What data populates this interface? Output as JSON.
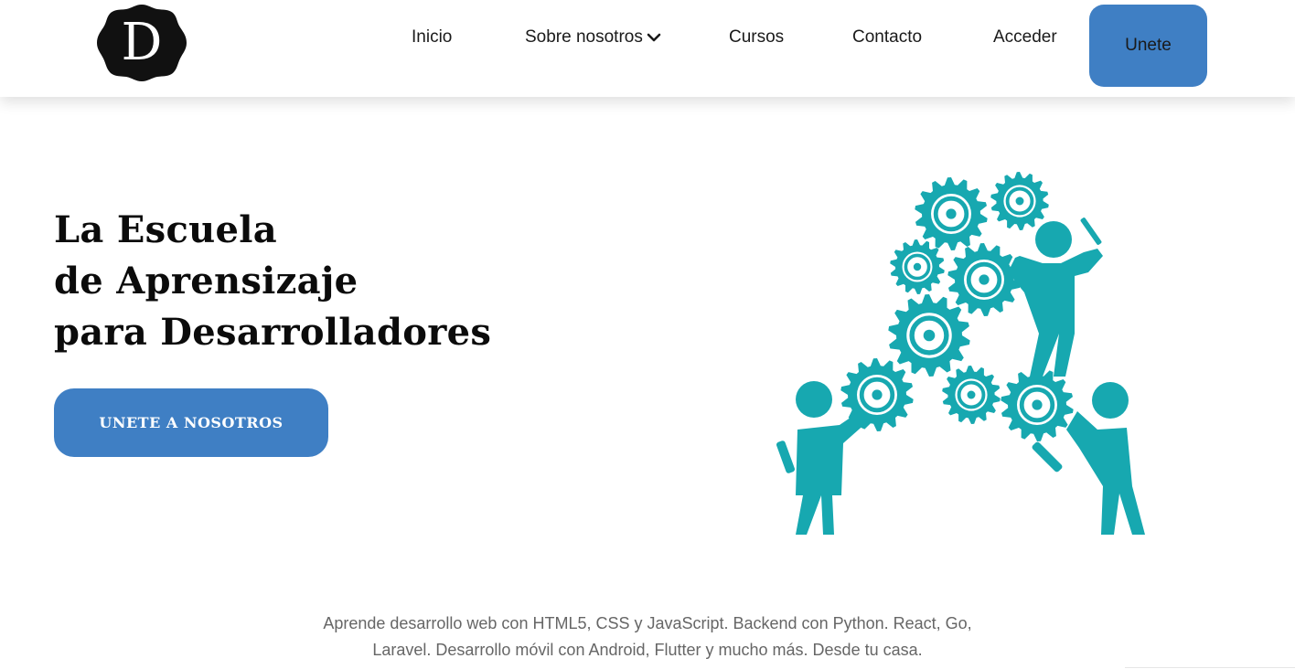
{
  "brand": {
    "letter": "D"
  },
  "nav": {
    "items": [
      {
        "label": "Inicio"
      },
      {
        "label": "Sobre nosotros"
      },
      {
        "label": "Cursos"
      },
      {
        "label": "Contacto"
      },
      {
        "label": "Acceder"
      }
    ],
    "cta_label": "Unete"
  },
  "hero": {
    "title_lines": [
      "La Escuela",
      "de Aprensizaje",
      "para Desarrolladores"
    ],
    "cta_label": "UNETE A NOSOTROS"
  },
  "tagline": {
    "lines": [
      "Aprende desarrollo web con HTML5, CSS y JavaScript. Backend con Python. React, Go,",
      "Laravel. Desarrollo móvil con Android, Flutter y mucho más. Desde tu casa."
    ]
  },
  "colors": {
    "accent_blue": "#3f7fc4",
    "illustration_teal": "#17a8b0",
    "logo_black": "#111111"
  },
  "icons": {
    "logo": "scalloped-badge-logo",
    "dropdown": "chevron-down-icon",
    "illustration": "people-assembling-gears"
  }
}
